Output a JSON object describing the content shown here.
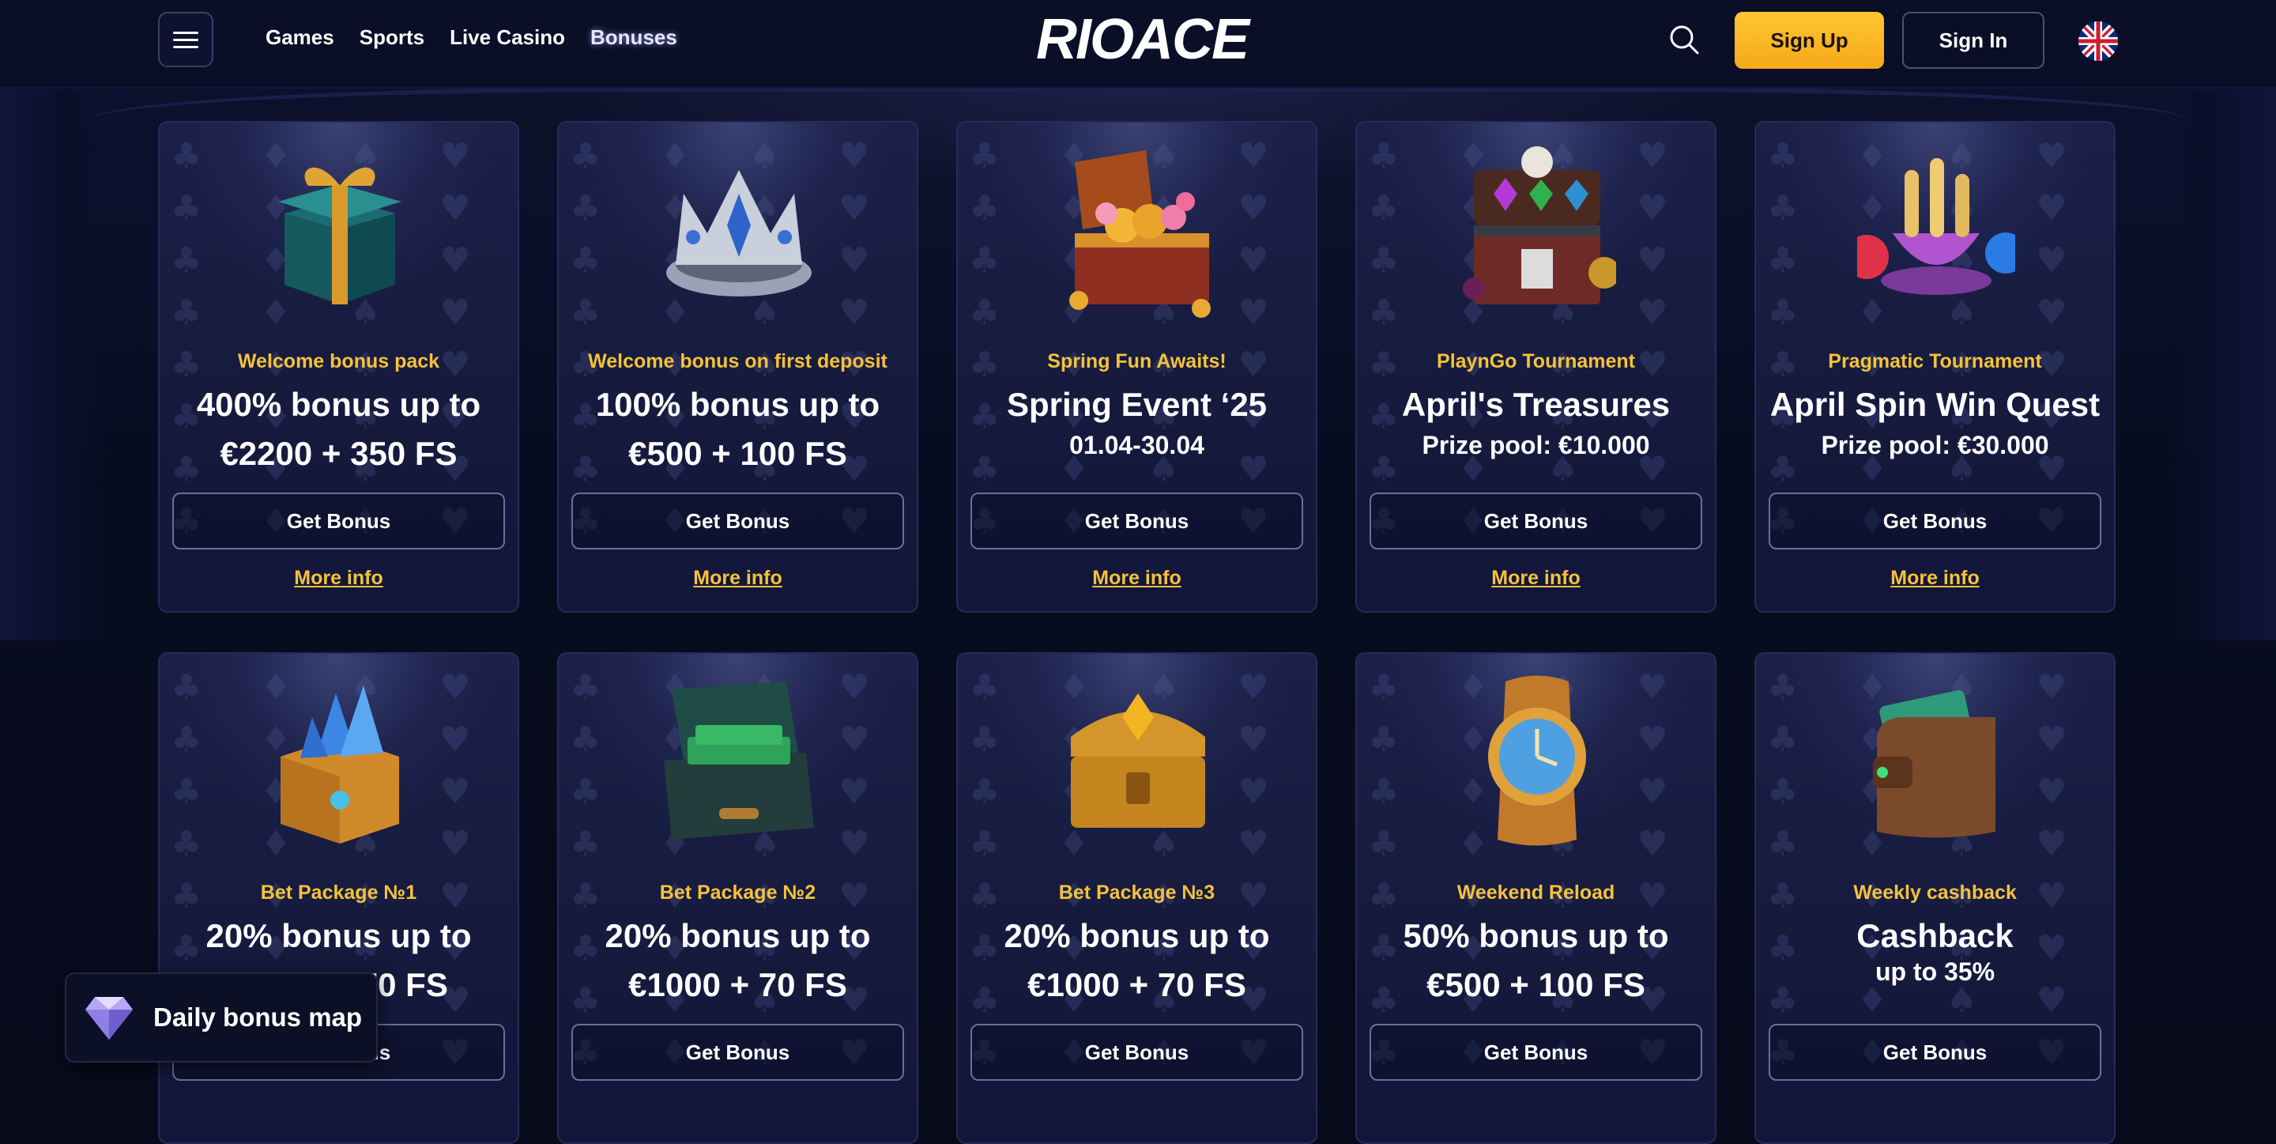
{
  "header": {
    "menu_icon": "hamburger-icon",
    "nav": [
      {
        "label": "Games"
      },
      {
        "label": "Sports"
      },
      {
        "label": "Live Casino"
      },
      {
        "label": "Bonuses",
        "active": true
      }
    ],
    "logo_text": "RIOACE",
    "search_icon": "search-icon",
    "sign_up": "Sign Up",
    "sign_in": "Sign In",
    "language_icon": "uk-flag-icon"
  },
  "colors": {
    "accent_yellow": "#f7c238",
    "signup_bg": "#ffc533",
    "page_bg": "#070b1c",
    "card_bg": "#1b2048"
  },
  "bonuses": [
    {
      "subtitle": "Welcome bonus pack",
      "title_line1": "400% bonus up to",
      "title_line2": "€2200 + 350 FS",
      "cta": "Get Bonus",
      "more": "More info",
      "icon": "gift-box-icon"
    },
    {
      "subtitle": "Welcome bonus on first deposit",
      "title_line1": "100% bonus up to",
      "title_line2": "€500 + 100 FS",
      "cta": "Get Bonus",
      "more": "More info",
      "icon": "crown-icon"
    },
    {
      "subtitle": "Spring Fun Awaits!",
      "title_line1": "Spring Event ‘25",
      "detail": "01.04-30.04",
      "cta": "Get Bonus",
      "more": "More info",
      "icon": "treasure-chest-flowers-icon"
    },
    {
      "subtitle": "PlaynGo Tournament",
      "title_line1": "April's Treasures",
      "detail": "Prize pool: €10.000",
      "cta": "Get Bonus",
      "more": "More info",
      "icon": "pirate-chest-icon"
    },
    {
      "subtitle": "Pragmatic Tournament",
      "title_line1": "April Spin Win Quest",
      "detail": "Prize pool: €30.000",
      "cta": "Get Bonus",
      "more": "More info",
      "icon": "candy-cup-icon"
    },
    {
      "subtitle": "Bet Package №1",
      "title_line1": "20% bonus up to",
      "title_line2": "€1000 + 70 FS",
      "cta": "Get Bonus",
      "icon": "crystal-chest-icon"
    },
    {
      "subtitle": "Bet Package №2",
      "title_line1": "20% bonus up to",
      "title_line2": "€1000 + 70 FS",
      "cta": "Get Bonus",
      "icon": "money-case-icon"
    },
    {
      "subtitle": "Bet Package №3",
      "title_line1": "20% bonus up to",
      "title_line2": "€1000 + 70 FS",
      "cta": "Get Bonus",
      "icon": "golden-chest-icon"
    },
    {
      "subtitle": "Weekend Reload",
      "title_line1": "50% bonus up to",
      "title_line2": "€500 + 100 FS",
      "cta": "Get Bonus",
      "icon": "gold-watch-icon"
    },
    {
      "subtitle": "Weekly cashback",
      "title_line1": "Cashback",
      "detail": "up to 35%",
      "cta": "Get Bonus",
      "icon": "wallet-icon"
    }
  ],
  "daily_bonus_map": {
    "label": "Daily bonus map",
    "icon": "diamond-icon"
  }
}
